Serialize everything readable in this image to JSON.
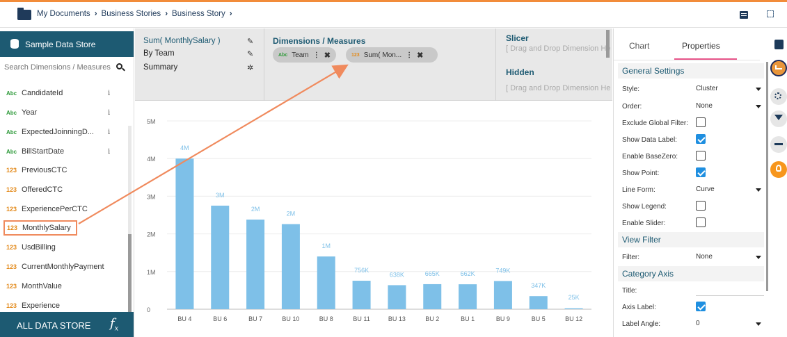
{
  "breadcrumb": [
    "My Documents",
    "Business Stories",
    "Business Story"
  ],
  "left_panel": {
    "datastore_title": "Sample Data Store",
    "search_placeholder": "Search Dimensions / Measures",
    "fields": [
      {
        "type": "Abc",
        "name": "CandidateId",
        "info": "i"
      },
      {
        "type": "Abc",
        "name": "Year",
        "info": "i"
      },
      {
        "type": "Abc",
        "name": "ExpectedJoinningD...",
        "info": "i"
      },
      {
        "type": "Abc",
        "name": "BillStartDate",
        "info": "i"
      },
      {
        "type": "123",
        "name": "PreviousCTC"
      },
      {
        "type": "123",
        "name": "OfferedCTC"
      },
      {
        "type": "123",
        "name": "ExperiencePerCTC"
      },
      {
        "type": "123",
        "name": "MonthlySalary"
      },
      {
        "type": "123",
        "name": "UsdBilling"
      },
      {
        "type": "123",
        "name": "CurrentMonthlyPayment"
      },
      {
        "type": "123",
        "name": "MonthValue"
      },
      {
        "type": "123",
        "name": "Experience"
      }
    ],
    "all_data_store": "ALL DATA STORE",
    "fx": "f"
  },
  "shelf": {
    "measure": "Sum( MonthlySalary )",
    "by": "By Team",
    "summary": "Summary",
    "dimensions_title": "Dimensions / Measures",
    "pills": [
      {
        "type": "Abc",
        "label": "Team"
      },
      {
        "type": "123",
        "label": "Sum( Mon..."
      }
    ],
    "slicer_title": "Slicer",
    "slicer_drop": "[ Drag and Drop Dimension Here ]",
    "hidden_title": "Hidden",
    "hidden_drop": "[ Drag and Drop Dimension Here ]"
  },
  "chart_data": {
    "type": "bar",
    "categories": [
      "BU 4",
      "BU 6",
      "BU 7",
      "BU 10",
      "BU 8",
      "BU 11",
      "BU 13",
      "BU 2",
      "BU 1",
      "BU 9",
      "BU 5",
      "BU 12"
    ],
    "values": [
      4000000,
      2750000,
      2380000,
      2260000,
      1400000,
      756000,
      638000,
      665000,
      662000,
      749000,
      347000,
      25000
    ],
    "data_labels": [
      "4M",
      "3M",
      "2M",
      "2M",
      "1M",
      "756K",
      "638K",
      "665K",
      "662K",
      "749K",
      "347K",
      "25K"
    ],
    "y_ticks": [
      "0",
      "1M",
      "2M",
      "3M",
      "4M",
      "5M"
    ],
    "ylim": [
      0,
      5000000
    ],
    "grid": true,
    "bar_color": "#7ec0e8",
    "label_color": "#7ec0e8"
  },
  "right_panel": {
    "tabs": [
      "Chart",
      "Properties"
    ],
    "general_settings": "General Settings",
    "props": [
      {
        "label": "Style:",
        "kind": "select",
        "value": "Cluster"
      },
      {
        "label": "Order:",
        "kind": "select",
        "value": "None"
      },
      {
        "label": "Exclude Global Filter:",
        "kind": "check",
        "value": false
      },
      {
        "label": "Show Data Label:",
        "kind": "check",
        "value": true
      },
      {
        "label": "Enable BaseZero:",
        "kind": "check",
        "value": false
      },
      {
        "label": "Show Point:",
        "kind": "check",
        "value": true
      },
      {
        "label": "Line Form:",
        "kind": "select",
        "value": "Curve"
      },
      {
        "label": "Show Legend:",
        "kind": "check",
        "value": false
      },
      {
        "label": "Enable Slider:",
        "kind": "check",
        "value": false
      }
    ],
    "view_filter": "View Filter",
    "filter": {
      "label": "Filter:",
      "value": "None"
    },
    "category_axis": "Category Axis",
    "axis_props": [
      {
        "label": "Title:",
        "kind": "text",
        "value": ""
      },
      {
        "label": "Axis Label:",
        "kind": "check",
        "value": true
      },
      {
        "label": "Label Angle:",
        "kind": "select",
        "value": "0"
      }
    ]
  }
}
